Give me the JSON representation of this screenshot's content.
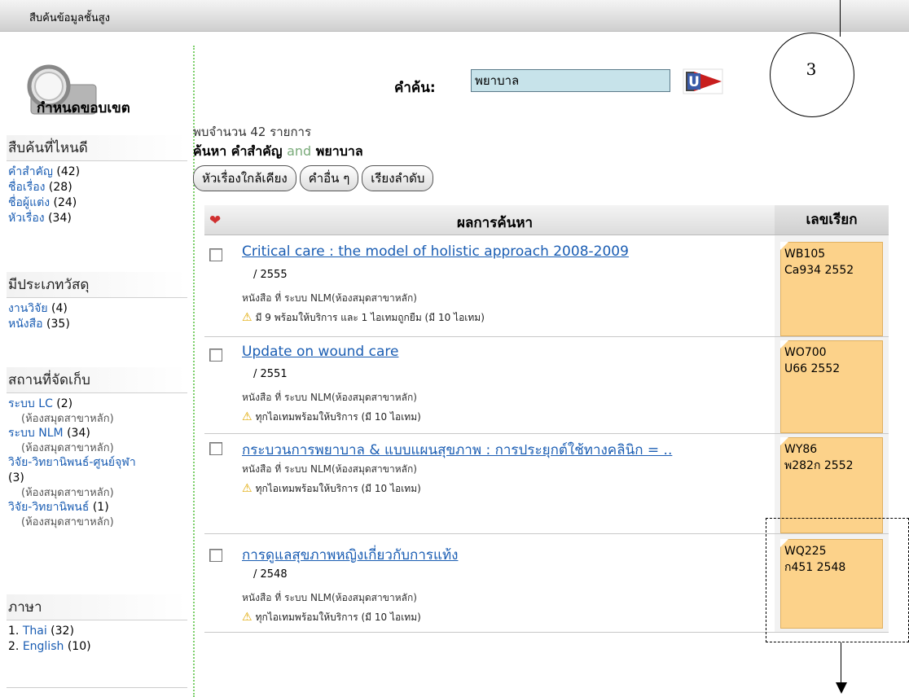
{
  "topbar": {
    "title": "สืบค้นข้อมูลชั้นสูง"
  },
  "sidebar": {
    "scope_title": "กำหนดขอบเขต",
    "sections": [
      {
        "heading": "สืบค้นที่ไหนดี",
        "items": [
          {
            "label": "คำสำคัญ",
            "count": "(42)"
          },
          {
            "label": "ชื่อเรื่อง",
            "count": "(28)"
          },
          {
            "label": "ชื่อผู้แต่ง",
            "count": "(24)"
          },
          {
            "label": "หัวเรื่อง",
            "count": "(34)"
          }
        ]
      },
      {
        "heading": "มีประเภทวัสดุ",
        "items": [
          {
            "label": "งานวิจัย",
            "count": "(4)"
          },
          {
            "label": "หนังสือ",
            "count": "(35)"
          }
        ]
      },
      {
        "heading": "สถานที่จัดเก็บ",
        "items": [
          {
            "label": "ระบบ LC",
            "count": "(2)",
            "sub": "(ห้องสมุดสาขาหลัก)"
          },
          {
            "label": "ระบบ NLM",
            "count": "(34)",
            "sub": "(ห้องสมุดสาขาหลัก)"
          },
          {
            "label": "วิจัย-วิทยานิพนธ์-ศูนย์จุฬา",
            "count": "(3)",
            "sub": "(ห้องสมุดสาขาหลัก)"
          },
          {
            "label": "วิจัย-วิทยานิพนธ์",
            "count": "(1)",
            "sub": "(ห้องสมุดสาขาหลัก)"
          }
        ]
      },
      {
        "heading": "ภาษา",
        "items": [
          {
            "prefix": "1.",
            "label": "Thai",
            "count": "(32)"
          },
          {
            "prefix": "2.",
            "label": "English",
            "count": "(10)"
          }
        ]
      }
    ]
  },
  "search": {
    "label": "คำค้น:",
    "value": "พยาบาล"
  },
  "summary": {
    "count_text": "พบจำนวน 42 รายการ",
    "query_prefix": "ค้นหา คำสำคัญ",
    "query_and": "and",
    "query_term": "พยาบาล"
  },
  "buttons": {
    "related_subjects": "หัวเรื่องใกล้เคียง",
    "other_terms": "คำอื่น ๆ",
    "sort": "เรียงลำดับ"
  },
  "results": {
    "header_main": "ผลการค้นหา",
    "header_call": "เลขเรียก",
    "rows": [
      {
        "title": "Critical care : the model of holistic approach 2008-2009",
        "year": "/ 2555",
        "location": "หนังสือ ที่ ระบบ NLM(ห้องสมุดสาขาหลัก)",
        "availability": "มี 9 พร้อมให้บริการ และ 1 ไอเทมถูกยืม (มี 10 ไอเทม)",
        "call_line1": "WB105",
        "call_line2": "Ca934 2552"
      },
      {
        "title": "Update on wound care",
        "year": "/ 2551",
        "location": "หนังสือ ที่ ระบบ NLM(ห้องสมุดสาขาหลัก)",
        "availability": "ทุกไอเทมพร้อมให้บริการ (มี 10 ไอเทม)",
        "call_line1": "WO700",
        "call_line2": "U66 2552"
      },
      {
        "title": "กระบวนการพยาบาล & แบบแผนสุขภาพ : การประยุกต์ใช้ทางคลินิก = ..",
        "year": "",
        "location": "หนังสือ ที่ ระบบ NLM(ห้องสมุดสาขาหลัก)",
        "availability": "ทุกไอเทมพร้อมให้บริการ (มี 10 ไอเทม)",
        "call_line1": "WY86",
        "call_line2": "พ282ก 2552"
      },
      {
        "title": "การดูแลสุขภาพหญิงเกี่ยวกับการแท้ง",
        "year": "/ 2548",
        "location": "หนังสือ ที่ ระบบ NLM(ห้องสมุดสาขาหลัก)",
        "availability": "ทุกไอเทมพร้อมให้บริการ (มี 10 ไอเทม)",
        "call_line1": "WQ225",
        "call_line2": "ก451 2548"
      }
    ]
  },
  "annotation": {
    "step_number": "3"
  }
}
